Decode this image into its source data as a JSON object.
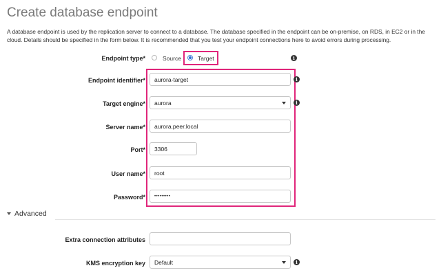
{
  "page": {
    "title": "Create database endpoint",
    "description": "A database endpoint is used by the replication server to connect to a database. The database specified in the endpoint can be on-premise, on RDS, in EC2 or in the cloud. Details should be specified in the form below. It is recommended that you test your endpoint connections here to avoid errors during processing."
  },
  "form": {
    "endpoint_type": {
      "label": "Endpoint type*",
      "options": [
        "Source",
        "Target"
      ],
      "selected": "Target"
    },
    "endpoint_identifier": {
      "label": "Endpoint identifier*",
      "value": "aurora-target"
    },
    "target_engine": {
      "label": "Target engine*",
      "value": "aurora"
    },
    "server_name": {
      "label": "Server name*",
      "value": "aurora.peer.local"
    },
    "port": {
      "label": "Port*",
      "value": "3306"
    },
    "user_name": {
      "label": "User name*",
      "value": "root"
    },
    "password": {
      "label": "Password*",
      "value": "•••••••••"
    }
  },
  "advanced": {
    "toggle_label": "Advanced",
    "extra_connection_attributes": {
      "label": "Extra connection attributes",
      "value": ""
    },
    "kms_encryption_key": {
      "label": "KMS encryption key",
      "value": "Default"
    }
  },
  "colors": {
    "highlight": "#e0257a",
    "radio_selected": "#2a6fd6",
    "title": "#7a7a7a"
  },
  "icons": {
    "info": "info-icon",
    "dropdown": "chevron-down-icon",
    "toggle": "caret-down-icon"
  }
}
